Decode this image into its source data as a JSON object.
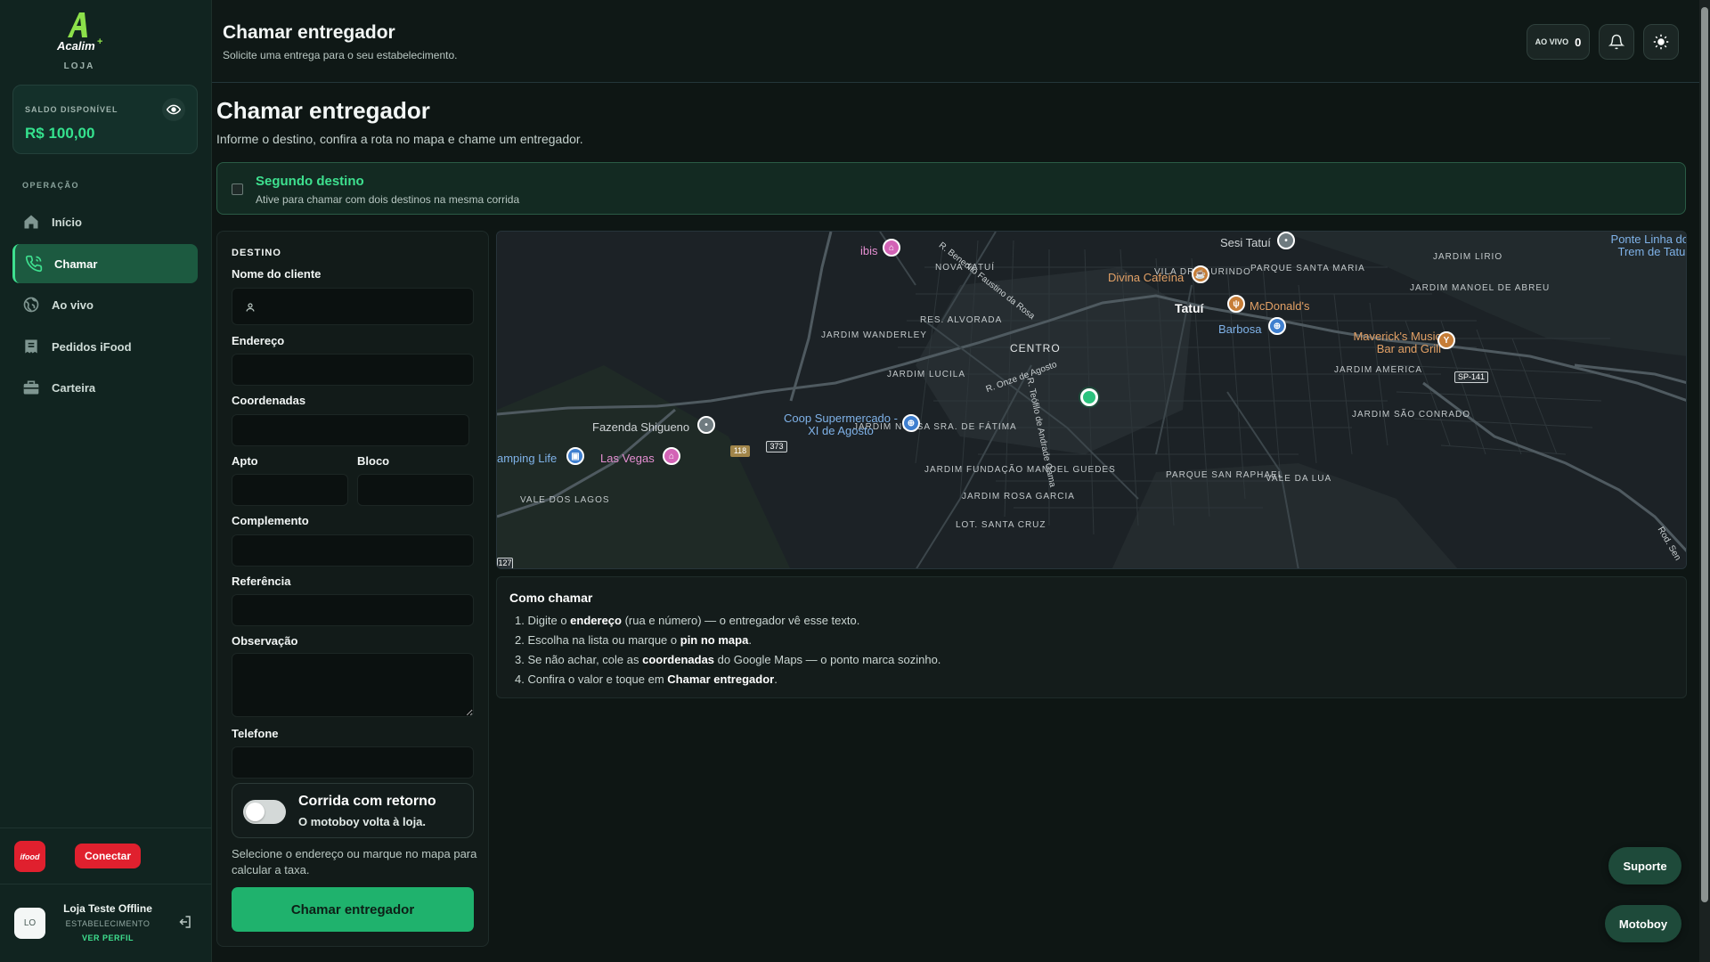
{
  "app": {
    "logo_text": "Acalim+",
    "logo_subtitle": "LOJA"
  },
  "sidebar": {
    "balance_label": "SALDO DISPONÍVEL",
    "balance_value": "R$ 100,00",
    "section_label": "OPERAÇÃO",
    "items": [
      {
        "label": "Início",
        "icon": "home-icon",
        "active": false
      },
      {
        "label": "Chamar",
        "icon": "phone-icon",
        "active": true
      },
      {
        "label": "Ao vivo",
        "icon": "globe-icon",
        "active": false
      },
      {
        "label": "Pedidos iFood",
        "icon": "receipt-icon",
        "active": false
      },
      {
        "label": "Carteira",
        "icon": "briefcase-icon",
        "active": false
      }
    ],
    "ifood_logo": "ifood",
    "connect_label": "Conectar",
    "user": {
      "avatar": "LO",
      "name": "Loja Teste Offline",
      "role": "ESTABELECIMENTO",
      "link": "VER PERFIL"
    }
  },
  "header": {
    "title": "Chamar entregador",
    "subtitle": "Solicite uma entrega para o seu estabelecimento.",
    "live_label": "AO VIVO",
    "live_count": "0"
  },
  "main": {
    "title": "Chamar entregador",
    "subtitle": "Informe o destino, confira a rota no mapa e chame um entregador.",
    "second_destination": {
      "title": "Segundo destino",
      "description": "Ative para chamar com dois destinos na mesma corrida"
    }
  },
  "form": {
    "section": "DESTINO",
    "customer_name_label": "Nome do cliente",
    "address_label": "Endereço",
    "coords_label": "Coordenadas",
    "apt_label": "Apto",
    "block_label": "Bloco",
    "complement_label": "Complemento",
    "reference_label": "Referência",
    "note_label": "Observação",
    "phone_label": "Telefone",
    "return_title": "Corrida com retorno",
    "return_subtitle": "O motoboy volta à loja.",
    "fee_hint": "Selecione o endereço ou marque no mapa para calcular a taxa.",
    "submit_label": "Chamar entregador"
  },
  "map": {
    "area_labels": [
      "NOVA TATUÍ",
      "VILA DR LAURINDO",
      "PARQUE SANTA MARIA",
      "JARDIM LIRIO",
      "JARDIM MANOEL DE ABREU",
      "RES. ALVORADA",
      "JARDIM WANDERLEY",
      "CENTRO",
      "JARDIM LUCILA",
      "JARDIM AMERICA",
      "JARDIM SÃO CONRADO",
      "JARDIM NOSSA SRA. DE FÁTIMA",
      "JARDIM FUNDAÇÃO MANOEL GUEDES",
      "PARQUE SAN RAPHAEL",
      "VALE DA LUA",
      "VALE DOS LAGOS",
      "JARDIM ROSA GARCIA",
      "LOT. SANTA CRUZ"
    ],
    "city": "Tatuí",
    "pois": [
      "ibis",
      "Sesi Tatuí",
      "Divina Cafeína",
      "McDonald's",
      "Barbosa",
      "Maverick's Music Bar and Grill",
      "Ponte Linha do Trem de Tatuí",
      "Fazenda Shigueno",
      "Coop Supermercado - XI de Agosto",
      "Las Vegas",
      "amping Life"
    ],
    "streets": [
      "R. Benedito Faustino da Rosa",
      "R. Onze de Agosto",
      "R. Teófilo de Andrade Gama",
      "Rod. Sen"
    ],
    "route_shields": [
      "SP-141",
      "118",
      "373",
      "127"
    ]
  },
  "howto": {
    "title": "Como chamar",
    "steps": [
      {
        "a": "Digite o ",
        "b": "endereço",
        "c": " (rua e número) — o entregador vê esse texto."
      },
      {
        "a": "Escolha na lista ou marque o ",
        "b": "pin no mapa",
        "c": "."
      },
      {
        "a": "Se não achar, cole as ",
        "b": "coordenadas",
        "c": " do Google Maps — o ponto marca sozinho."
      },
      {
        "a": "Confira o valor e toque em ",
        "b": "Chamar entregador",
        "c": "."
      }
    ]
  },
  "floating": {
    "support_label": "Suporte",
    "motoboy_label": "Motoboy"
  },
  "colors": {
    "accent": "#3ee08f",
    "primary_button": "#1fb26d",
    "ifood_red": "#e0202e"
  }
}
